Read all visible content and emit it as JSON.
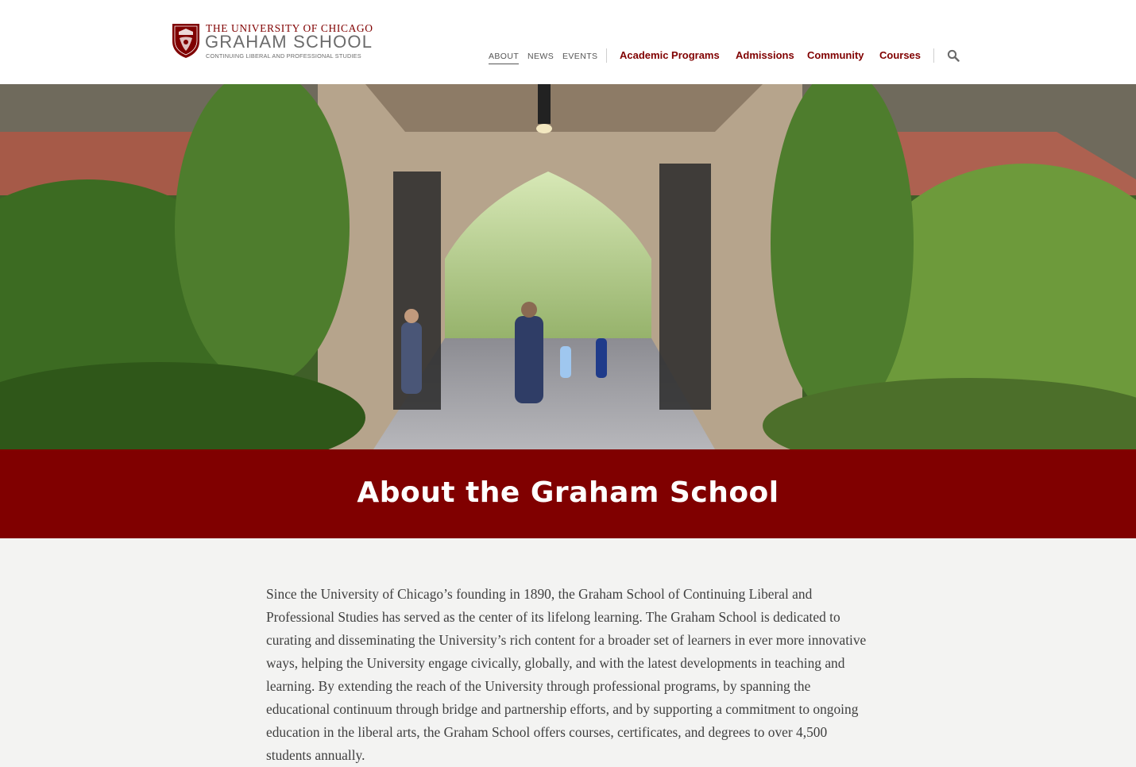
{
  "logo": {
    "line1": "THE UNIVERSITY OF CHICAGO",
    "line2": "GRAHAM SCHOOL",
    "line3": "CONTINUING LIBERAL AND PROFESSIONAL STUDIES"
  },
  "utility_nav": {
    "about": "ABOUT",
    "news": "NEWS",
    "events": "EVENTS"
  },
  "main_nav": {
    "academic_programs": "Academic Programs",
    "admissions": "Admissions",
    "community": "Community",
    "courses": "Courses"
  },
  "search": {
    "icon": "search-icon"
  },
  "hero": {
    "alt": "campus-gate-photo"
  },
  "banner": {
    "title": "About the Graham School"
  },
  "intro": {
    "text": "Since the University of Chicago’s founding in 1890, the Graham School of Continuing Liberal and Professional Studies has served as the center of its lifelong learning. The Graham School is dedicated to curating and disseminating the University’s rich content for a broader set of learners in ever more innovative ways, helping the University engage civically, globally, and with the latest developments in teaching and learning. By extending the reach of the University through professional programs, by spanning the educational continuum through bridge and partnership efforts, and by supporting a commitment to ongoing education in the liberal arts, the Graham School offers courses, certificates, and degrees to over 4,500 students annually."
  },
  "colors": {
    "maroon": "#800000",
    "background": "#f3f3f2",
    "nav_text": "#555555"
  }
}
